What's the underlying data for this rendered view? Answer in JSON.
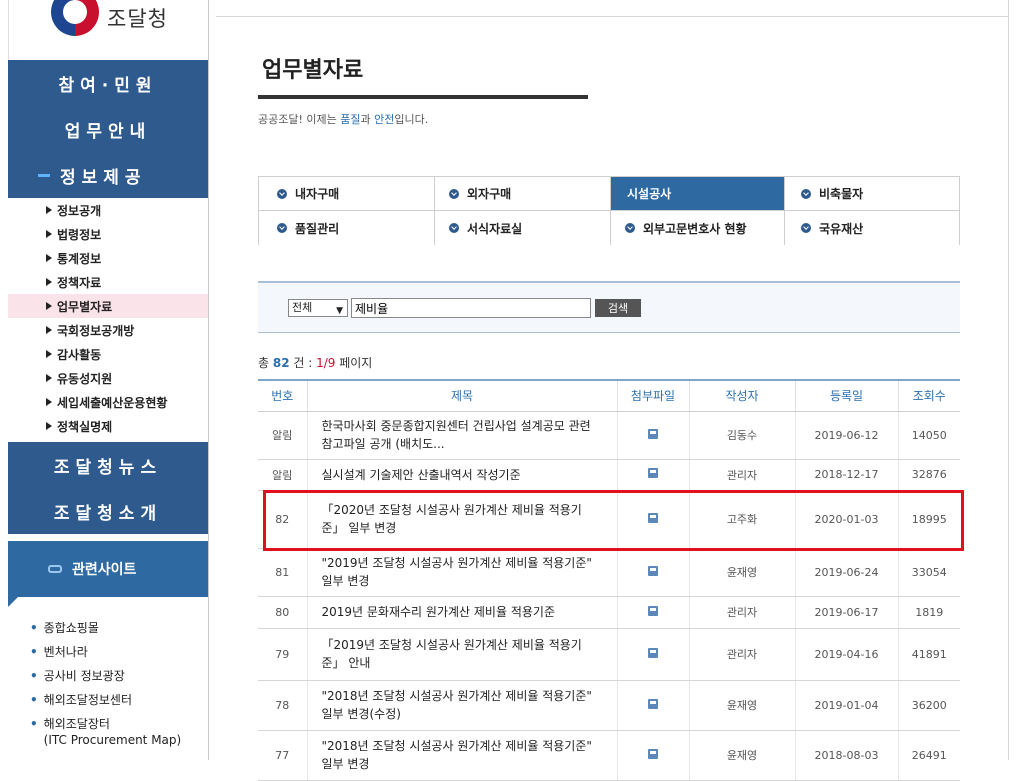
{
  "brand": {
    "name": "조달청"
  },
  "sidebar": {
    "main_menu": [
      "참여·민원",
      "업무안내",
      "정보제공"
    ],
    "active_main": "정보제공",
    "sub_items": [
      "정보공개",
      "법령정보",
      "통계정보",
      "정책자료",
      "업무별자료",
      "국회정보공개방",
      "감사활동",
      "유동성지원",
      "세입세출예산운용현황",
      "정책실명제"
    ],
    "active_sub": "업무별자료",
    "main_menu_2": [
      "조달청뉴스",
      "조달청소개"
    ],
    "related_label": "관련사이트",
    "related_sites": [
      "종합쇼핑몰",
      "벤처나라",
      "공사비 정보광장",
      "해외조달정보센터",
      "해외조달장터\n(ITC Procurement Map)"
    ]
  },
  "page": {
    "title": "업무별자료",
    "subtitle_pre": "공공조달! 이제는 ",
    "subtitle_hl1": "품질",
    "subtitle_mid": "과 ",
    "subtitle_hl2": "안전",
    "subtitle_post": "입니다."
  },
  "tabs": [
    {
      "label": "내자구매",
      "active": false
    },
    {
      "label": "외자구매",
      "active": false
    },
    {
      "label": "시설공사",
      "active": true
    },
    {
      "label": "비축물자",
      "active": false
    },
    {
      "label": "품질관리",
      "active": false
    },
    {
      "label": "서식자료실",
      "active": false
    },
    {
      "label": "외부고문변호사 현황",
      "active": false
    },
    {
      "label": "국유재산",
      "active": false
    }
  ],
  "search": {
    "field_selected": "전체",
    "query": "제비율",
    "button_label": "검색"
  },
  "count": {
    "prefix": "총 ",
    "total": "82",
    "unit": " 건 : ",
    "page": "1/9",
    "suffix": " 페이지"
  },
  "table": {
    "headers": [
      "번호",
      "제목",
      "첨부파일",
      "작성자",
      "등록일",
      "조회수"
    ],
    "rows": [
      {
        "no": "알림",
        "title": "한국마사회 중문종합지원센터 건립사업 설계공모 관련 참고파일 공개 (배치도...",
        "attach": true,
        "author": "김동수",
        "date": "2019-06-12",
        "views": "14050"
      },
      {
        "no": "알림",
        "title": "실시설계 기술제안 산출내역서 작성기준",
        "attach": true,
        "author": "관리자",
        "date": "2018-12-17",
        "views": "32876"
      },
      {
        "no": "82",
        "title": "「2020년 조달청 시설공사 원가계산 제비율 적용기준」 일부 변경",
        "attach": true,
        "author": "고주화",
        "date": "2020-01-03",
        "views": "18995"
      },
      {
        "no": "81",
        "title": "\"2019년 조달청 시설공사 원가계산 제비율 적용기준\" 일부 변경",
        "attach": true,
        "author": "윤재영",
        "date": "2019-06-24",
        "views": "33054"
      },
      {
        "no": "80",
        "title": "2019년 문화재수리 원가계산 제비율 적용기준",
        "attach": true,
        "author": "관리자",
        "date": "2019-06-17",
        "views": "1819"
      },
      {
        "no": "79",
        "title": "「2019년 조달청 시설공사 원가계산 제비율 적용기준」 안내",
        "attach": true,
        "author": "관리자",
        "date": "2019-04-16",
        "views": "41891"
      },
      {
        "no": "78",
        "title": "\"2018년 조달청 시설공사 원가계산 제비율 적용기준\" 일부 변경(수정)",
        "attach": true,
        "author": "윤재영",
        "date": "2019-01-04",
        "views": "36200"
      },
      {
        "no": "77",
        "title": "\"2018년 조달청 시설공사 원가계산 제비율 적용기준\" 일부 변경",
        "attach": true,
        "author": "윤재영",
        "date": "2018-08-03",
        "views": "26491"
      }
    ]
  },
  "colors": {
    "nav_blue": "#2e5a8e",
    "accent_blue": "#2a6fb0",
    "highlight_red": "#e01020"
  }
}
